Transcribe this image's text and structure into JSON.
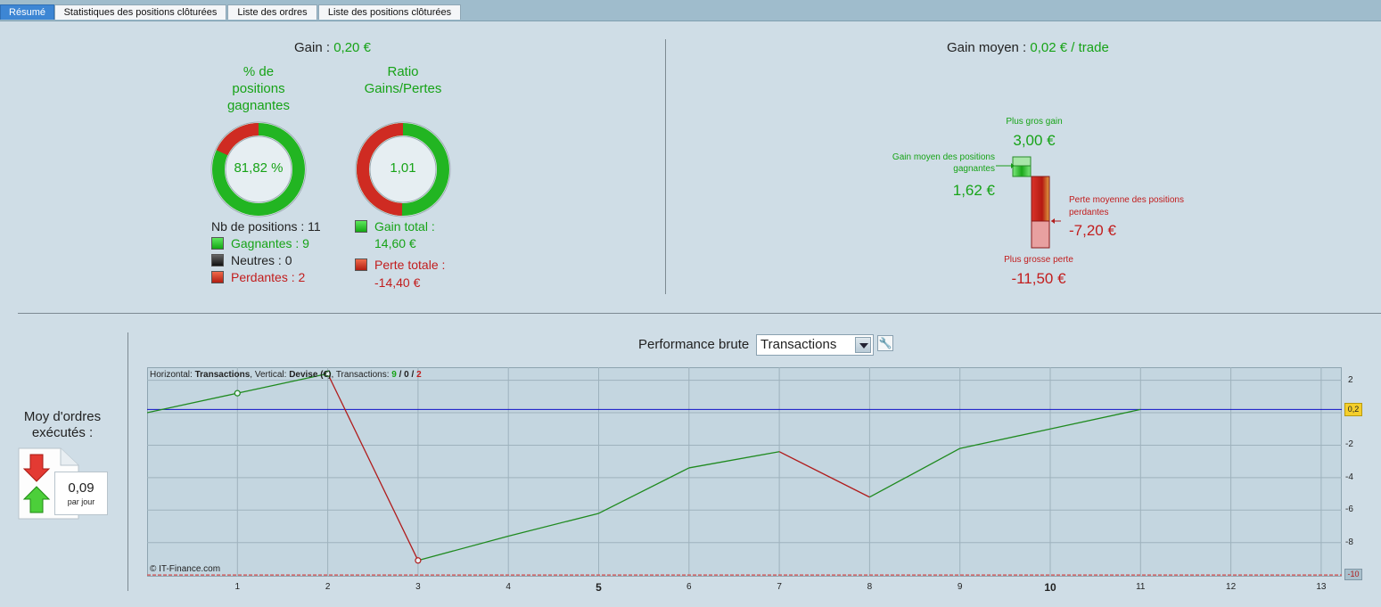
{
  "tabs": [
    {
      "label": "Résumé",
      "active": true
    },
    {
      "label": "Statistiques des positions clôturées",
      "active": false
    },
    {
      "label": "Liste des ordres",
      "active": false
    },
    {
      "label": "Liste des positions clôturées",
      "active": false
    }
  ],
  "summary": {
    "gain_label": "Gain :",
    "gain_value": "0,20 €",
    "win_pct_title_1": "% de",
    "win_pct_title_2": "positions",
    "win_pct_title_3": "gagnantes",
    "win_pct_value": "81,82 %",
    "win_fraction": 0.8182,
    "ratio_title_1": "Ratio",
    "ratio_title_2": "Gains/Pertes",
    "ratio_value": "1,01",
    "ratio_win_fraction": 0.5035,
    "nb_positions": "Nb de positions : 11",
    "winners": "Gagnantes : 9",
    "neutral": "Neutres : 0",
    "losers": "Perdantes : 2",
    "gain_total_label": "Gain total :",
    "gain_total_value": "14,60 €",
    "loss_total_label": "Perte totale :",
    "loss_total_value": "-14,40 €"
  },
  "avg": {
    "label": "Gain moyen :",
    "value": "0,02 € / trade",
    "biggest_gain_label": "Plus gros gain",
    "biggest_gain_value": "3,00 €",
    "avg_win_label_1": "Gain moyen des positions",
    "avg_win_label_2": "gagnantes",
    "avg_win_value": "1,62 €",
    "avg_loss_label_1": "Perte moyenne des positions",
    "avg_loss_label_2": "perdantes",
    "avg_loss_value": "-7,20 €",
    "biggest_loss_label": "Plus grosse perte",
    "biggest_loss_value": "-11,50 €"
  },
  "orders": {
    "label_1": "Moy d'ordres",
    "label_2": "exécutés :",
    "value": "0,09",
    "unit": "par jour"
  },
  "performance": {
    "label": "Performance brute",
    "select_value": "Transactions",
    "info_prefix": "Horizontal: ",
    "info_h": "Transactions",
    "info_mid": ", Vertical: ",
    "info_v": "Devise (€)",
    "info_tx": ", Transactions: ",
    "info_w": "9",
    "info_sep1": " / ",
    "info_n": "0",
    "info_sep2": " / ",
    "info_l": "2",
    "watermark": "© IT-Finance.com",
    "current_marker": "0,2",
    "bottom_marker": "-10"
  },
  "chart_data": {
    "type": "line",
    "x": [
      0,
      1,
      2,
      3,
      4,
      5,
      6,
      7,
      8,
      9,
      10,
      11
    ],
    "y": [
      0,
      1.2,
      2.4,
      -9.1,
      -7.6,
      -6.2,
      -3.4,
      -2.4,
      -5.2,
      -2.2,
      -1.0,
      0.2
    ],
    "segment_colors": [
      "green",
      "green",
      "red",
      "green",
      "green",
      "green",
      "green",
      "red",
      "green",
      "green",
      "green"
    ],
    "reference_line": 0.2,
    "x_ticks": [
      "1",
      "2",
      "3",
      "4",
      "5",
      "6",
      "7",
      "8",
      "9",
      "10",
      "11",
      "12",
      "13"
    ],
    "y_ticks": [
      "2",
      "-2",
      "-4",
      "-6",
      "-8"
    ],
    "xlim": [
      0,
      13.2
    ],
    "ylim": [
      -10.1,
      2.8
    ],
    "grid": true,
    "colors": {
      "win": "#1f8a1f",
      "loss": "#b01c1c",
      "reference": "#1010c8"
    }
  }
}
